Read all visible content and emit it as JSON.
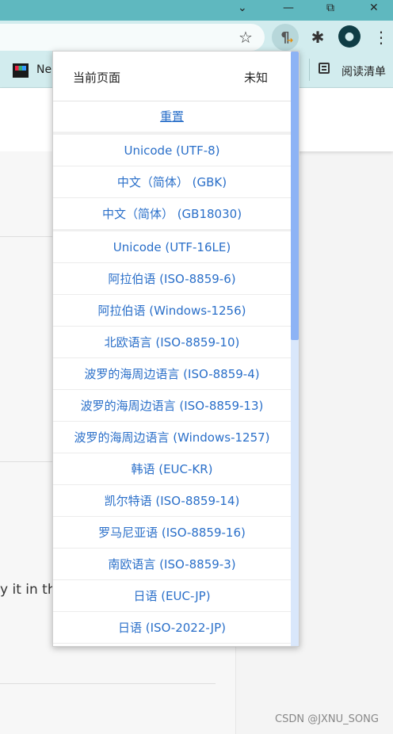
{
  "window": {
    "minimize": "—",
    "restore": "⧉",
    "close": "✕",
    "chevron": "⌄"
  },
  "toolbar": {
    "star_icon": "☆",
    "encoding_icon": "¶",
    "extensions_icon": "✱",
    "profile_icon": "●",
    "menu_icon": "⋮"
  },
  "bookmarks": {
    "item1_label": "Ne",
    "reading_list_label": "阅读清单"
  },
  "page": {
    "partial_text": "y it in the"
  },
  "dropdown": {
    "current_page_label": "当前页面",
    "current_page_value": "未知",
    "reset_label": "重置",
    "encodings": [
      "Unicode (UTF-8)",
      "中文（简体） (GBK)",
      "中文（简体） (GB18030)",
      "Unicode (UTF-16LE)",
      "阿拉伯语 (ISO-8859-6)",
      "阿拉伯语 (Windows-1256)",
      "北欧语言 (ISO-8859-10)",
      "波罗的海周边语言 (ISO-8859-4)",
      "波罗的海周边语言 (ISO-8859-13)",
      "波罗的海周边语言 (Windows-1257)",
      "韩语 (EUC-KR)",
      "凯尔特语 (ISO-8859-14)",
      "罗马尼亚语 (ISO-8859-16)",
      "南欧语言 (ISO-8859-3)",
      "日语 (EUC-JP)",
      "日语 (ISO-2022-JP)"
    ]
  },
  "watermark": "CSDN @JXNU_SONG",
  "colors": {
    "titlebar": "#5fb8bf",
    "toolbar": "#d2ecee",
    "link": "#2a6fc9",
    "scrollbar_thumb": "#8db3f5",
    "scrollbar_track": "#d9e7fb"
  }
}
